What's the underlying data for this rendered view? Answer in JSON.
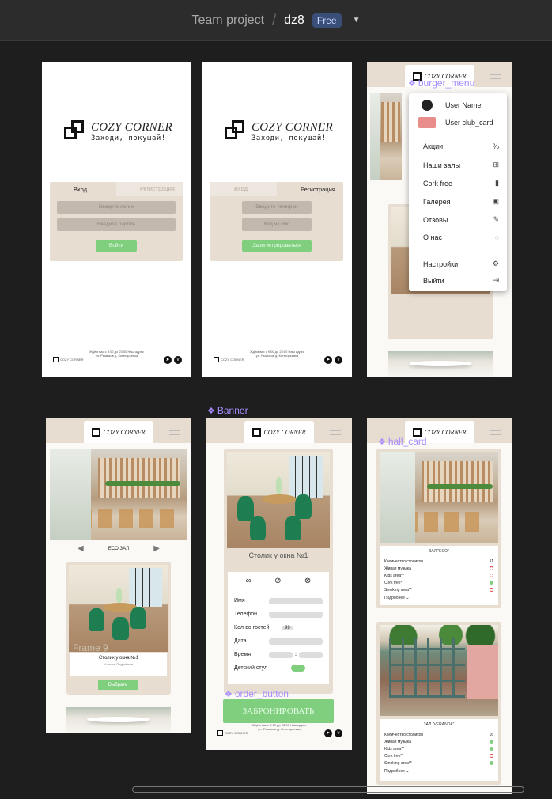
{
  "topbar": {
    "project": "Team project",
    "separator": "/",
    "file": "dz8",
    "plan": "Free",
    "dropdown": "⌄"
  },
  "logo": {
    "title": "COZY CORNER",
    "tagline": "Заходи, покушай!"
  },
  "login": {
    "tab_login": "Вход",
    "tab_register": "Регистрация",
    "login_placeholder": "Введите логин",
    "password_placeholder": "Введите пароль",
    "submit": "Войти"
  },
  "register": {
    "tab_login": "Вход",
    "tab_register": "Регистрация",
    "phone_placeholder": "Введите телефон",
    "sms_placeholder": "Код из смс",
    "submit": "Зарегистрироваться"
  },
  "footer": {
    "brand": "COZY CORNER",
    "address": "Ждём вас с 9:00 до 23:00 Наш адрес ул. Рыжиков д. Котегорьевка"
  },
  "labels": {
    "burger": "burger_menu",
    "banner": "Banner",
    "order": "order_button",
    "hall": "hall_card",
    "frame": "Frame 9"
  },
  "menu": {
    "user_name": "User Name",
    "club": "User  club_card",
    "items": [
      "Акции",
      "Наши залы",
      "Cork free",
      "Галерея",
      "Отзовы",
      "О нас",
      "Настройки",
      "Выйти"
    ]
  },
  "hall_nav": {
    "name": "ECO ЗАЛ"
  },
  "table_card": {
    "title": "Столик у окна №1",
    "details": "4 гостя, Подробнее",
    "button": "Выбрать"
  },
  "order": {
    "title": "Столик у окна №1",
    "fields": [
      "Имя",
      "Телефон",
      "Кол-во гостей",
      "Дата",
      "Время",
      "Детский стул"
    ],
    "guests": "99",
    "button": "ЗАБРОНИРОВАТЬ"
  },
  "hall_eco": {
    "title": "ЗАЛ \"ECO\"",
    "rows": [
      "Количество столиков",
      "Живая музыка",
      "Kids area**",
      "Cork free**",
      "Smoking area**"
    ],
    "count": "11",
    "more": "Подробнее"
  },
  "hall_veranda": {
    "title": "ЗАЛ \"VERANDA\"",
    "rows": [
      "Количество столиков",
      "Живая музыка",
      "Kids area**",
      "Cork free**",
      "Smoking area**"
    ],
    "count": "16",
    "more": "Подробнее"
  }
}
